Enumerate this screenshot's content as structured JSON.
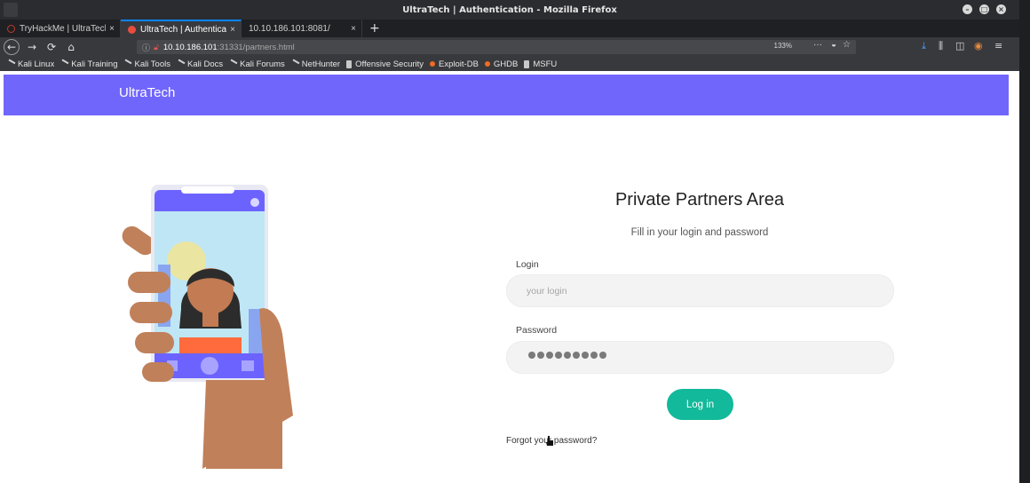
{
  "window": {
    "title": "UltraTech | Authentication - Mozilla Firefox"
  },
  "tabs": [
    {
      "label": "TryHackMe | UltraTech",
      "close": "×",
      "favicon_color": "#c0392b"
    },
    {
      "label": "UltraTech | Authentication",
      "close": "×",
      "favicon_color": "#e74c3c"
    },
    {
      "label": "10.10.186.101:8081/",
      "close": "×",
      "favicon_color": ""
    }
  ],
  "newtab_label": "+",
  "nav": {
    "url_host": "10.10.186.101",
    "url_rest": ":31331/partners.html",
    "zoom": "133%",
    "page_actions": "···"
  },
  "bookmarks": [
    {
      "label": "Kali Linux",
      "icon": "kali-icon"
    },
    {
      "label": "Kali Training",
      "icon": "kali-icon"
    },
    {
      "label": "Kali Tools",
      "icon": "kali-icon"
    },
    {
      "label": "Kali Docs",
      "icon": "kali-icon"
    },
    {
      "label": "Kali Forums",
      "icon": "kali-icon"
    },
    {
      "label": "NetHunter",
      "icon": "kali-icon"
    },
    {
      "label": "Offensive Security",
      "icon": "offsec-icon"
    },
    {
      "label": "Exploit-DB",
      "icon": "exploitdb-icon"
    },
    {
      "label": "GHDB",
      "icon": "exploitdb-icon"
    },
    {
      "label": "MSFU",
      "icon": "offsec-icon"
    }
  ],
  "site": {
    "brand": "UltraTech",
    "header_color": "#7166fb"
  },
  "form": {
    "title": "Private Partners Area",
    "subtitle": "Fill in your login and password",
    "login_label": "Login",
    "login_placeholder": "your login",
    "password_label": "Password",
    "password_mask_length": 9,
    "submit_label": "Log in",
    "forgot_link": "Forgot your password?",
    "accent": "#12b99a"
  }
}
